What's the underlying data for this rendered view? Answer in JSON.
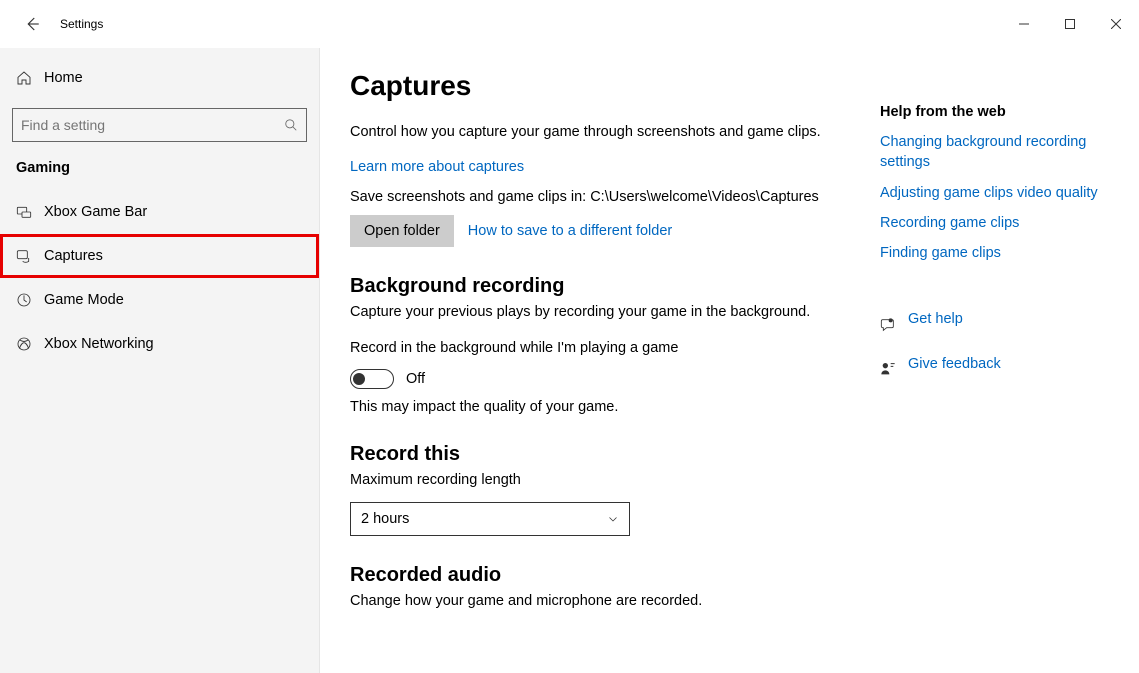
{
  "window": {
    "title": "Settings"
  },
  "sidebar": {
    "home_label": "Home",
    "search_placeholder": "Find a setting",
    "section_label": "Gaming",
    "items": [
      {
        "label": "Xbox Game Bar"
      },
      {
        "label": "Captures"
      },
      {
        "label": "Game Mode"
      },
      {
        "label": "Xbox Networking"
      }
    ]
  },
  "page": {
    "title": "Captures",
    "intro": "Control how you capture your game through screenshots and game clips.",
    "learn_more_link": "Learn more about captures",
    "save_path_prefix": "Save screenshots and game clips in: ",
    "save_path": "C:\\Users\\welcome\\Videos\\Captures",
    "open_folder_btn": "Open folder",
    "how_to_save_link": "How to save to a different folder",
    "bg_recording": {
      "heading": "Background recording",
      "sub": "Capture your previous plays by recording your game in the background.",
      "toggle_label": "Record in the background while I'm playing a game",
      "toggle_state": "Off",
      "note": "This may impact the quality of your game."
    },
    "record_this": {
      "heading": "Record this",
      "label": "Maximum recording length",
      "value": "2 hours"
    },
    "recorded_audio": {
      "heading": "Recorded audio",
      "sub": "Change how your game and microphone are recorded."
    }
  },
  "aside": {
    "help_heading": "Help from the web",
    "links": [
      "Changing background recording settings",
      "Adjusting game clips video quality",
      "Recording game clips",
      "Finding game clips"
    ],
    "get_help": "Get help",
    "give_feedback": "Give feedback"
  }
}
